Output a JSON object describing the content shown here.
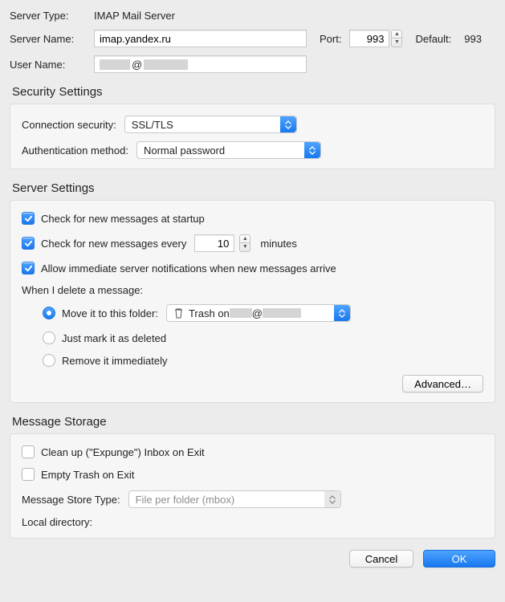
{
  "top": {
    "server_type_label": "Server Type:",
    "server_type_value": "IMAP Mail Server",
    "server_name_label": "Server Name:",
    "server_name_value": "imap.yandex.ru",
    "port_label": "Port:",
    "port_value": "993",
    "default_label": "Default:",
    "default_value": "993",
    "user_name_label": "User Name:",
    "user_name_value": "        @            "
  },
  "security": {
    "title": "Security Settings",
    "connection_security_label": "Connection security:",
    "connection_security_value": "SSL/TLS",
    "auth_method_label": "Authentication method:",
    "auth_method_value": "Normal password"
  },
  "server": {
    "title": "Server Settings",
    "check_startup": {
      "checked": true,
      "label": "Check for new messages at startup"
    },
    "check_every": {
      "checked": true,
      "label_before": "Check for new messages every",
      "value": "10",
      "label_after": "minutes"
    },
    "allow_notifications": {
      "checked": true,
      "label": "Allow immediate server notifications when new messages arrive"
    },
    "when_delete_label": "When I delete a message:",
    "delete_options": {
      "move": {
        "selected": true,
        "label": "Move it to this folder:",
        "folder_prefix": "Trash on ",
        "folder_suffix_hidden": "    @        "
      },
      "mark": {
        "selected": false,
        "label": "Just mark it as deleted"
      },
      "remove": {
        "selected": false,
        "label": "Remove it immediately"
      }
    },
    "advanced_label": "Advanced…"
  },
  "storage": {
    "title": "Message Storage",
    "expunge": {
      "checked": false,
      "label": "Clean up (\"Expunge\") Inbox on Exit"
    },
    "empty_trash": {
      "checked": false,
      "label": "Empty Trash on Exit"
    },
    "store_type_label": "Message Store Type:",
    "store_type_value": "File per folder (mbox)",
    "local_dir_label": "Local directory:"
  },
  "buttons": {
    "cancel": "Cancel",
    "ok": "OK"
  }
}
